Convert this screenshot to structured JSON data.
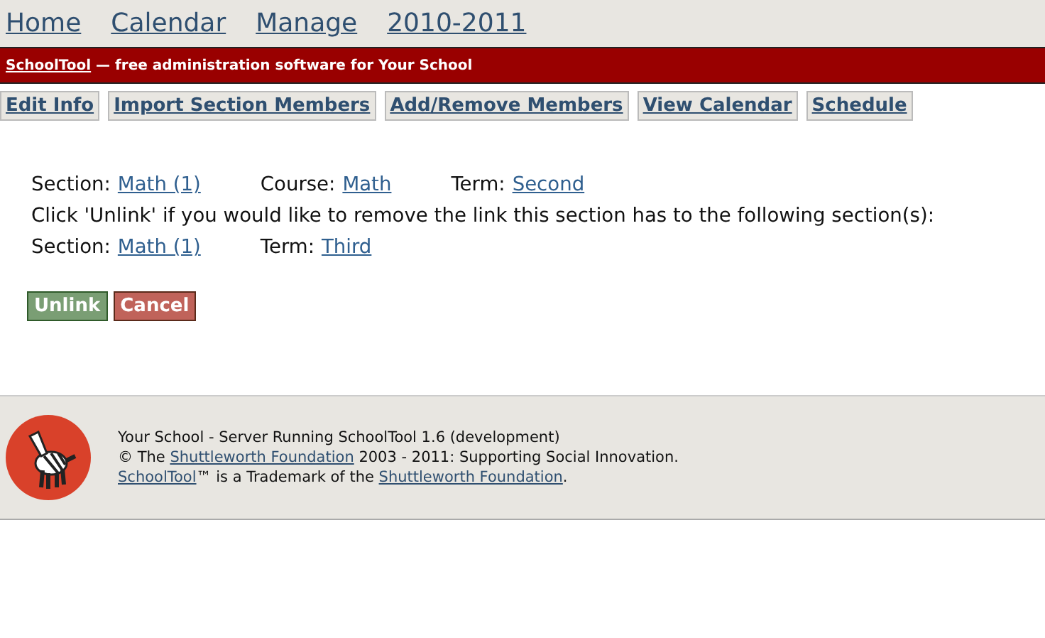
{
  "nav": [
    "Home",
    "Calendar",
    "Manage",
    "2010-2011"
  ],
  "banner": {
    "link": "SchoolTool",
    "text": " — free administration software for Your School"
  },
  "actions": [
    "Edit Info",
    "Import Section Members",
    "Add/Remove Members",
    "View Calendar",
    "Schedule"
  ],
  "current": [
    {
      "label": "Section:",
      "value": "Math (1)"
    },
    {
      "label": "Course:",
      "value": "Math"
    },
    {
      "label": "Term:",
      "value": "Second"
    }
  ],
  "message": "Click 'Unlink' if you would like to remove the link this section has to the following section(s):",
  "linked": [
    {
      "label": "Section:",
      "value": "Math (1)"
    },
    {
      "label": "Term:",
      "value": "Third"
    }
  ],
  "buttons": [
    {
      "label": "Unlink",
      "kind": "primary"
    },
    {
      "label": "Cancel",
      "kind": "cancel"
    }
  ],
  "footer": [
    [
      {
        "text": "Your School - Server Running SchoolTool 1.6 (development)",
        "link": false
      }
    ],
    [
      {
        "text": "© The ",
        "link": false
      },
      {
        "text": "Shuttleworth Foundation",
        "link": true
      },
      {
        "text": " 2003 - 2011: Supporting Social Innovation.",
        "link": false
      }
    ],
    [
      {
        "text": "SchoolTool",
        "link": true
      },
      {
        "text": "™ is a Trademark of the ",
        "link": false
      },
      {
        "text": "Shuttleworth Foundation",
        "link": true
      },
      {
        "text": ".",
        "link": false
      }
    ]
  ]
}
